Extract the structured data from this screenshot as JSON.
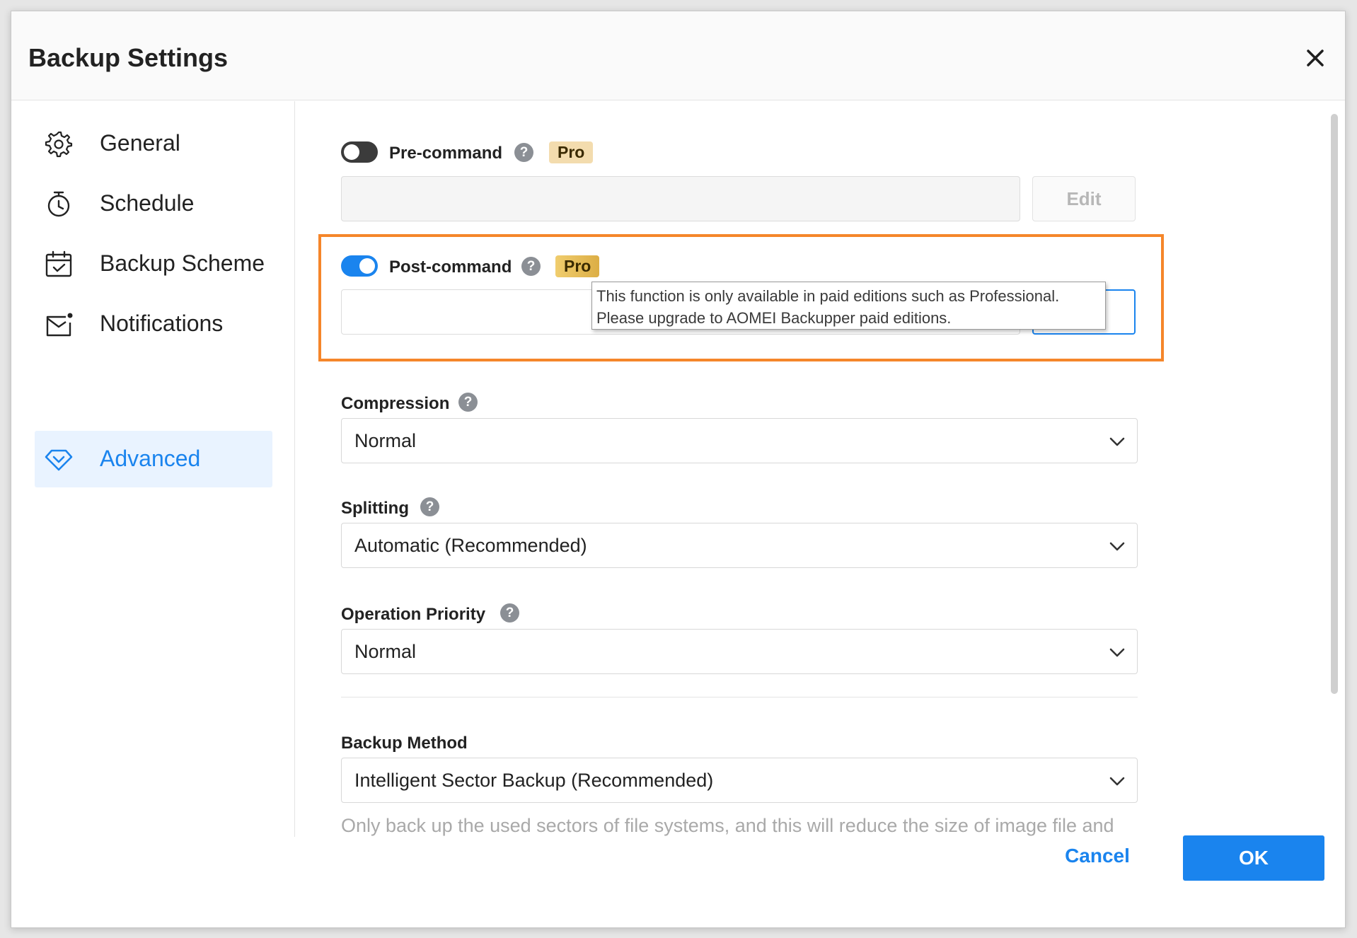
{
  "dialog": {
    "title": "Backup Settings",
    "close_icon": "close-icon"
  },
  "sidebar": {
    "items": [
      {
        "label": "General",
        "icon": "gear-icon"
      },
      {
        "label": "Schedule",
        "icon": "timer-icon"
      },
      {
        "label": "Backup Scheme",
        "icon": "calendar-check-icon"
      },
      {
        "label": "Notifications",
        "icon": "mail-icon"
      },
      {
        "label": "Advanced",
        "icon": "diamond-icon",
        "active": true
      }
    ]
  },
  "pre_command": {
    "label": "Pre-command",
    "help": "?",
    "badge": "Pro",
    "enabled": false,
    "edit_label": "Edit",
    "value": ""
  },
  "post_command": {
    "label": "Post-command",
    "help": "?",
    "badge": "Pro",
    "enabled": true,
    "value": ""
  },
  "tooltip": {
    "line1": "This function is only available in paid editions such as Professional.",
    "line2": "Please upgrade to AOMEI Backupper paid editions."
  },
  "compression": {
    "label": "Compression",
    "help": "?",
    "value": "Normal"
  },
  "splitting": {
    "label": "Splitting",
    "help": "?",
    "value": "Automatic (Recommended)"
  },
  "operation_priority": {
    "label": "Operation Priority",
    "help": "?",
    "value": "Normal"
  },
  "backup_method": {
    "label": "Backup Method",
    "value": "Intelligent Sector Backup (Recommended)",
    "description": "Only back up the used sectors of file systems, and this will reduce the size of image file and backup time."
  },
  "footer": {
    "cancel_label": "Cancel",
    "ok_label": "OK"
  },
  "colors": {
    "accent": "#1a84ee",
    "highlight": "#f5862a",
    "pro_badge": "#f0cd6e"
  }
}
